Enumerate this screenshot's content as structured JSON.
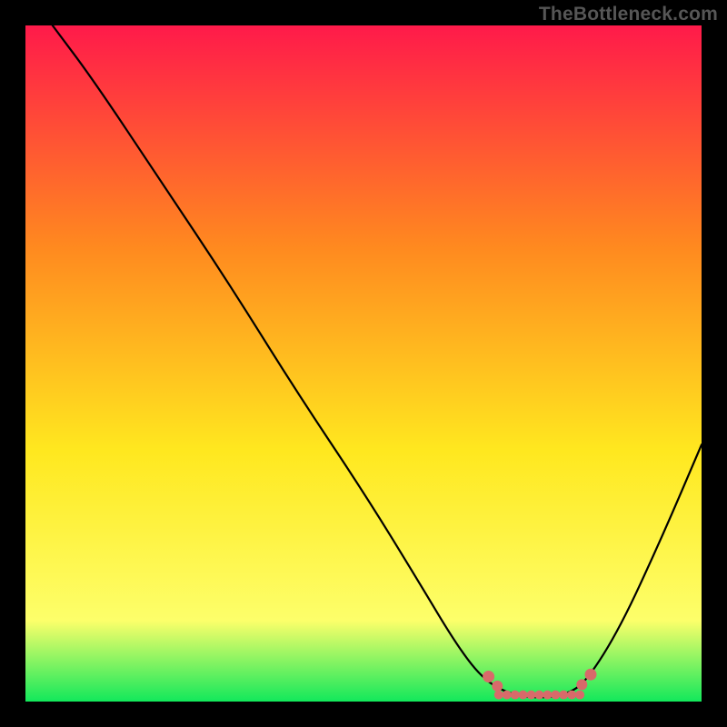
{
  "watermark": "TheBottleneck.com",
  "chart_data": {
    "type": "line",
    "title": "",
    "xlabel": "",
    "ylabel": "",
    "xlim": [
      0,
      100
    ],
    "ylim": [
      0,
      100
    ],
    "gradient_colors": {
      "top": "#ff1a4a",
      "upper_mid": "#ff8a1f",
      "mid": "#ffe81f",
      "lower_mid": "#fdff6a",
      "bottom": "#12e85b"
    },
    "curve": {
      "description": "Bottleneck curve: high on left, descends to a wide minimum around x≈72-82, rises toward right edge (partial).",
      "points": [
        {
          "x": 4,
          "y": 100
        },
        {
          "x": 10,
          "y": 92
        },
        {
          "x": 20,
          "y": 77
        },
        {
          "x": 30,
          "y": 62
        },
        {
          "x": 40,
          "y": 46
        },
        {
          "x": 50,
          "y": 31
        },
        {
          "x": 58,
          "y": 18
        },
        {
          "x": 64,
          "y": 8
        },
        {
          "x": 68,
          "y": 3
        },
        {
          "x": 72,
          "y": 1
        },
        {
          "x": 76,
          "y": 0.5
        },
        {
          "x": 80,
          "y": 1
        },
        {
          "x": 83,
          "y": 3
        },
        {
          "x": 88,
          "y": 11
        },
        {
          "x": 94,
          "y": 24
        },
        {
          "x": 100,
          "y": 38
        }
      ]
    },
    "markers": {
      "color": "#d86a6a",
      "left_cluster": {
        "x_start": 68,
        "x_end": 70,
        "y": 2.5
      },
      "flat_band": {
        "x_start": 70,
        "x_end": 82,
        "y": 1
      },
      "right_cluster": {
        "x_start": 82,
        "x_end": 84,
        "y": 3
      }
    }
  }
}
